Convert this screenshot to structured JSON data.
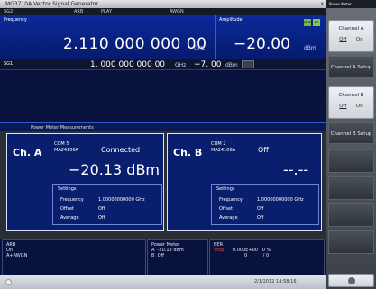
{
  "window": {
    "title": "MG3710A Vector Signal Generator",
    "close": "x"
  },
  "status": {
    "sg": "SG2",
    "arb": "ARB",
    "play": "PLAY",
    "awgn": "AWGN"
  },
  "frequency": {
    "label": "Frequency",
    "value": "2.110 000 000 00",
    "unit": "GHz"
  },
  "amplitude": {
    "label": "Amplitude",
    "value": "−20.00",
    "unit": "dBm",
    "badges": [
      "MOD",
      "RF"
    ],
    "badge_colors": [
      "#74b94a",
      "#8fc24a"
    ]
  },
  "sg1": {
    "label": "SG1",
    "freq": "1. 000 000 000 00",
    "freq_unit": "GHz",
    "amp": "−7. 00",
    "amp_unit": "dBm"
  },
  "power_meter": {
    "header": "Power Meter Measurements",
    "channels": [
      {
        "title": "Ch. A",
        "com": "COM 5",
        "model": "MA24106A",
        "state": "Connected",
        "value": "−20.13 dBm",
        "settings_header": "Settings",
        "freq_label": "Frequency",
        "freq_value": "1.00000000000 GHz",
        "offset_label": "Offset",
        "offset_value": "Off",
        "avg_label": "Average",
        "avg_value": "Off"
      },
      {
        "title": "Ch. B",
        "com": "COM 2",
        "model": "MA24106A",
        "state": "Off",
        "value": "--.--",
        "settings_header": "Settings",
        "freq_label": "Frequency",
        "freq_value": "1.00000000000 GHz",
        "offset_label": "Offset",
        "offset_value": "Off",
        "avg_label": "Average",
        "avg_value": "Off"
      }
    ]
  },
  "bottom": {
    "arb": {
      "title": "ARB",
      "line1": "On",
      "line2": "A+AWGN"
    },
    "pm": {
      "title": "Power Meter",
      "a_label": "A",
      "a_value": "-20.13 dBm",
      "b_label": "B",
      "b_value": "Off"
    },
    "ber": {
      "title": "BER",
      "state": "Stop",
      "rate": "0.000E+00",
      "pct": "0 %",
      "count": "0",
      "total": "/ 0"
    }
  },
  "taskbar": {
    "datetime": "2/1/2012 14:58:16"
  },
  "side": {
    "title": "Power Meter",
    "channel_a": "Channel A",
    "channel_a_off": "Off",
    "channel_a_on": "On",
    "channel_a_setup": "Channel A Setup",
    "channel_b": "Channel B",
    "channel_b_off": "Off",
    "channel_b_on": "On",
    "channel_b_setup": "Channel B Setup"
  }
}
